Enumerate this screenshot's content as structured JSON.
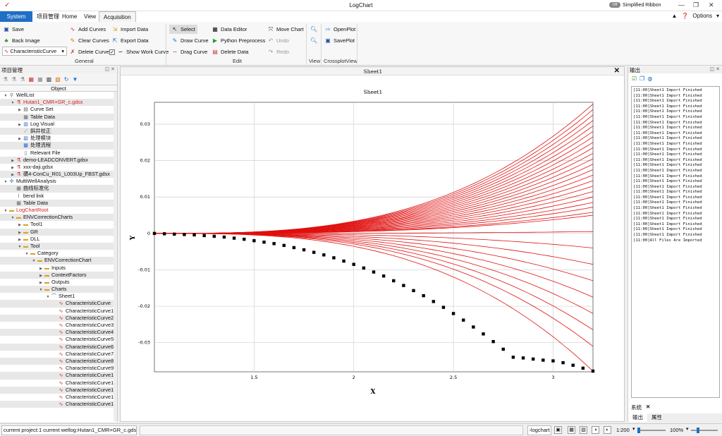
{
  "window": {
    "title": "LogChart",
    "ribbon_toggle_label": "Off",
    "ribbon_mode": "Simplified Ribbon"
  },
  "tabs": [
    "System",
    "项目管理",
    "Home",
    "View",
    "Acquisition"
  ],
  "options_label": "Options",
  "ribbon": {
    "general": {
      "label": "General",
      "save": "Save",
      "back_image": "Back Image",
      "curve_combo": "CharacteristicCurve",
      "add_curves": "Add Curves",
      "clear_curves": "Clear Curves",
      "delete_curve": "Delete Curve",
      "import_data": "Import Data",
      "export_data": "Export Data",
      "show_work_curve": "Show Work Curve"
    },
    "edit": {
      "label": "Edit",
      "select": "Select",
      "draw_curve": "Draw Curve",
      "drag_curve": "Drag Curve",
      "data_editor": "Data Editor",
      "python_preprocess": "Python Preprocess",
      "delete_data": "Delete Data",
      "move_chart": "Move Chart",
      "undo": "Undo",
      "redo": "Redo"
    },
    "view": {
      "label": "View"
    },
    "crossplot": {
      "label": "CrossplotView",
      "open_plot": "OpenPlot",
      "save_plot": "SavePlot"
    }
  },
  "left_panel": {
    "title": "项目管理",
    "column_header": "Object",
    "tree": [
      {
        "label": "WellList",
        "level": 0,
        "arrow": "down",
        "icon": "well-icon"
      },
      {
        "label": "Hutan1_CMR+GR_c.gdsx",
        "level": 1,
        "arrow": "down",
        "icon": "well-file-icon",
        "red": true
      },
      {
        "label": "Curve Set",
        "level": 2,
        "arrow": "right",
        "icon": "curveset-icon"
      },
      {
        "label": "Table Data",
        "level": 2,
        "arrow": "",
        "icon": "table-icon"
      },
      {
        "label": "Log Visual",
        "level": 2,
        "arrow": "right",
        "icon": "logvisual-icon"
      },
      {
        "label": "斜井校正",
        "level": 2,
        "arrow": "",
        "icon": "correction-icon"
      },
      {
        "label": "处理模块",
        "level": 2,
        "arrow": "right",
        "icon": "module-icon"
      },
      {
        "label": "处理流程",
        "level": 2,
        "arrow": "",
        "icon": "flow-icon"
      },
      {
        "label": "Relevant File",
        "level": 2,
        "arrow": "",
        "icon": "file-icon"
      },
      {
        "label": "demo-LEADCONVERT.gdsx",
        "level": 1,
        "arrow": "right",
        "icon": "well-file-icon"
      },
      {
        "label": "xxx-daji.gdsx",
        "level": 1,
        "arrow": "right",
        "icon": "well-file-icon"
      },
      {
        "label": "磺4-ConCu_R01_L003Up_FBST.gdsx",
        "level": 1,
        "arrow": "right",
        "icon": "well-file-icon"
      },
      {
        "label": "MultiWellAnalysis",
        "level": 0,
        "arrow": "down",
        "icon": "multiwell-icon"
      },
      {
        "label": "曲线标准化",
        "level": 1,
        "arrow": "",
        "icon": "normalize-icon"
      },
      {
        "label": "bend link",
        "level": 1,
        "arrow": "",
        "icon": "link-icon"
      },
      {
        "label": "Table Data",
        "level": 1,
        "arrow": "",
        "icon": "table-icon"
      },
      {
        "label": "LogChartRoot",
        "level": 0,
        "arrow": "down",
        "icon": "folder-icon",
        "red": true
      },
      {
        "label": "ENVCorrectionCharts",
        "level": 1,
        "arrow": "down",
        "icon": "folder-icon"
      },
      {
        "label": "Tool1",
        "level": 2,
        "arrow": "right",
        "icon": "folder-icon"
      },
      {
        "label": "GR",
        "level": 2,
        "arrow": "right",
        "icon": "folder-icon"
      },
      {
        "label": "DLL",
        "level": 2,
        "arrow": "right",
        "icon": "folder-icon"
      },
      {
        "label": "Tool",
        "level": 2,
        "arrow": "down",
        "icon": "folder-icon"
      },
      {
        "label": "Category",
        "level": 3,
        "arrow": "down",
        "icon": "folder-icon"
      },
      {
        "label": "ENVCorrectionChart",
        "level": 4,
        "arrow": "down",
        "icon": "folder-icon"
      },
      {
        "label": "Inputs",
        "level": 5,
        "arrow": "right",
        "icon": "folder-icon"
      },
      {
        "label": "ContextFactors",
        "level": 5,
        "arrow": "right",
        "icon": "folder-icon"
      },
      {
        "label": "Outputs",
        "level": 5,
        "arrow": "right",
        "icon": "folder-icon"
      },
      {
        "label": "Charts",
        "level": 5,
        "arrow": "down",
        "icon": "folder-icon"
      },
      {
        "label": "Sheet1",
        "level": 6,
        "arrow": "down",
        "icon": "chart-icon"
      },
      {
        "label": "CharacteristicCurve",
        "level": 7,
        "arrow": "",
        "icon": "curve-icon"
      },
      {
        "label": "CharacteristicCurve1",
        "level": 7,
        "arrow": "",
        "icon": "curve-icon"
      },
      {
        "label": "CharacteristicCurve2",
        "level": 7,
        "arrow": "",
        "icon": "curve-icon"
      },
      {
        "label": "CharacteristicCurve3",
        "level": 7,
        "arrow": "",
        "icon": "curve-icon"
      },
      {
        "label": "CharacteristicCurve4",
        "level": 7,
        "arrow": "",
        "icon": "curve-icon"
      },
      {
        "label": "CharacteristicCurve5",
        "level": 7,
        "arrow": "",
        "icon": "curve-icon"
      },
      {
        "label": "CharacteristicCurve6",
        "level": 7,
        "arrow": "",
        "icon": "curve-icon"
      },
      {
        "label": "CharacteristicCurve7",
        "level": 7,
        "arrow": "",
        "icon": "curve-icon"
      },
      {
        "label": "CharacteristicCurve8",
        "level": 7,
        "arrow": "",
        "icon": "curve-icon"
      },
      {
        "label": "CharacteristicCurve9",
        "level": 7,
        "arrow": "",
        "icon": "curve-icon"
      },
      {
        "label": "CharacteristicCurve1",
        "level": 7,
        "arrow": "",
        "icon": "curve-icon"
      },
      {
        "label": "CharacteristicCurve1",
        "level": 7,
        "arrow": "",
        "icon": "curve-icon"
      },
      {
        "label": "CharacteristicCurve1",
        "level": 7,
        "arrow": "",
        "icon": "curve-icon"
      },
      {
        "label": "CharacteristicCurve1",
        "level": 7,
        "arrow": "",
        "icon": "curve-icon"
      },
      {
        "label": "CharacteristicCurve1",
        "level": 7,
        "arrow": "",
        "icon": "curve-icon"
      }
    ]
  },
  "document": {
    "tab_title": "Sheet1"
  },
  "chart_data": {
    "type": "line",
    "title": "Sheet1",
    "xlabel": "X",
    "ylabel": "Y",
    "xlim": [
      1.0,
      3.2
    ],
    "ylim": [
      -0.038,
      0.036
    ],
    "x_ticks": [
      1.5,
      2,
      2.5,
      3
    ],
    "y_ticks": [
      0.03,
      0.02,
      0.01,
      0,
      -0.01,
      -0.02,
      -0.03
    ],
    "x_tick_labels": [
      "1.5",
      "2",
      "2.5",
      "3"
    ],
    "y_tick_labels": [
      "0.03",
      "0.02",
      "0.01",
      "0",
      "-0.01",
      "-0.02",
      "-0.03"
    ],
    "grid": true,
    "curve_color": "#e01010",
    "curve_family": {
      "x_start": 1.0,
      "x_end": 3.2,
      "end_values": [
        0.0355,
        0.034,
        0.0325,
        0.031,
        0.0295,
        0.028,
        0.0265,
        0.025,
        0.0235,
        0.022,
        0.0205,
        0.019,
        0.0175,
        0.016,
        0.0145,
        0.013,
        0.0115,
        0.01,
        0.0085,
        0.0072,
        0.0058,
        0.005,
        0.0005,
        -0.004,
        -0.0085,
        -0.013,
        -0.0175,
        -0.022,
        -0.0265,
        -0.031,
        -0.0378
      ]
    },
    "markers": {
      "color": "#000000",
      "x": [
        1.0,
        1.05,
        1.1,
        1.15,
        1.2,
        1.25,
        1.3,
        1.35,
        1.4,
        1.45,
        1.5,
        1.55,
        1.6,
        1.65,
        1.7,
        1.75,
        1.8,
        1.85,
        1.9,
        1.95,
        2.0,
        2.05,
        2.1,
        2.15,
        2.2,
        2.25,
        2.3,
        2.35,
        2.4,
        2.45,
        2.5,
        2.55,
        2.6,
        2.65,
        2.7,
        2.75,
        2.8,
        2.85,
        2.9,
        2.95,
        3.0,
        3.05,
        3.1,
        3.15,
        3.2
      ],
      "y": [
        0,
        -0.0001,
        -0.0002,
        -0.0003,
        -0.0004,
        -0.0006,
        -0.0008,
        -0.001,
        -0.0013,
        -0.0016,
        -0.002,
        -0.0024,
        -0.0028,
        -0.0033,
        -0.0039,
        -0.0045,
        -0.0052,
        -0.0059,
        -0.0067,
        -0.0076,
        -0.0085,
        -0.0095,
        -0.0106,
        -0.0117,
        -0.013,
        -0.0143,
        -0.0157,
        -0.0171,
        -0.0187,
        -0.0203,
        -0.022,
        -0.0238,
        -0.0257,
        -0.0276,
        -0.0297,
        -0.0318,
        -0.034,
        -0.0342,
        -0.0345,
        -0.0348,
        -0.035,
        -0.0355,
        -0.0362,
        -0.037,
        -0.0378
      ]
    }
  },
  "right_panel": {
    "title": "输出",
    "log_lines": [
      "[11:00]Sheet1 Import Finished",
      "[11:00]Sheet1 Import Finished",
      "[11:00]Sheet1 Import Finished",
      "[11:00]Sheet1 Import Finished",
      "[11:00]Sheet1 Import Finished",
      "[11:00]Sheet1 Import Finished",
      "[11:00]Sheet1 Import Finished",
      "[11:00]Sheet1 Import Finished",
      "[11:00]Sheet1 Import Finished",
      "[11:00]Sheet1 Import Finished",
      "[11:00]Sheet1 Import Finished",
      "[11:00]Sheet1 Import Finished",
      "[11:00]Sheet1 Import Finished",
      "[11:00]Sheet1 Import Finished",
      "[11:00]Sheet1 Import Finished",
      "[11:00]Sheet1 Import Finished",
      "[11:00]Sheet1 Import Finished",
      "[11:00]Sheet1 Import Finished",
      "[11:00]Sheet1 Import Finished",
      "[11:00]Sheet1 Import Finished",
      "[11:00]Sheet1 Import Finished",
      "[11:00]Sheet1 Import Finished",
      "[11:00]Sheet1 Import Finished",
      "[11:00]Sheet1 Import Finished",
      "[11:00]Sheet1 Import Finished",
      "[11:00]Sheet1 Import Finished",
      "[11:00]Sheet1 Import Finished",
      "[11:00]Sheet1 Import Finished",
      "[11:00]All Files Are Imported"
    ],
    "sys_tab": "系统",
    "bottom_tabs": [
      "输出",
      "属性"
    ]
  },
  "statusbar": {
    "project": "current project:1  current wellog:Hutan1_CMR+GR_c.gdsx",
    "mode": "-logchart",
    "scale": "1:200",
    "zoom": "100%"
  }
}
